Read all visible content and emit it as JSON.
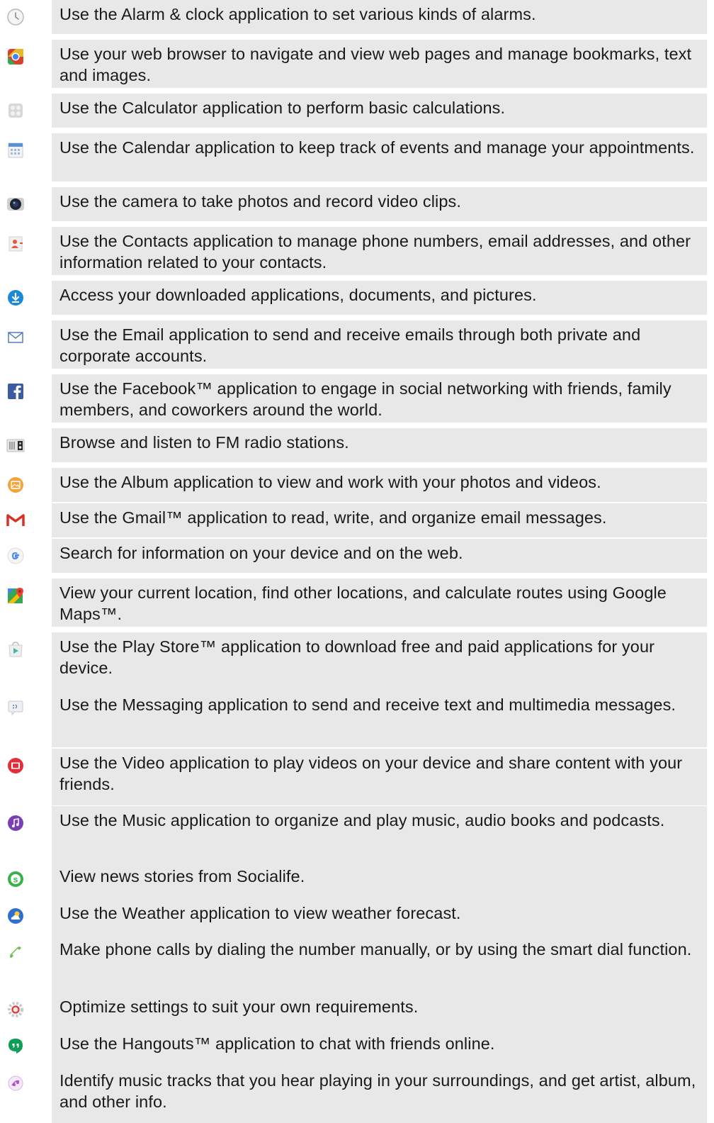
{
  "apps": [
    {
      "icon": "alarm-clock-icon",
      "text": "Use the Alarm & clock application to set various kinds of alarms."
    },
    {
      "icon": "web-browser-icon",
      "text": "Use your web browser to navigate and view web pages and manage bookmarks, text and images."
    },
    {
      "icon": "calculator-icon",
      "text": "Use the Calculator application to perform basic calculations."
    },
    {
      "icon": "calendar-icon",
      "text": "Use the Calendar application to keep track of events and manage your appointments."
    },
    {
      "icon": "camera-icon",
      "text": "Use the camera to take photos and record video clips."
    },
    {
      "icon": "contacts-icon",
      "text": "Use the Contacts application to manage phone numbers, email addresses, and other information related to your contacts."
    },
    {
      "icon": "downloads-icon",
      "text": "Access your downloaded applications, documents, and pictures."
    },
    {
      "icon": "email-icon",
      "text": "Use the Email application to send and receive emails through both private and corporate accounts."
    },
    {
      "icon": "facebook-icon",
      "text": "Use the Facebook™ application to engage in social networking with friends, family members, and coworkers around the world."
    },
    {
      "icon": "fm-radio-icon",
      "text": "Browse and listen to FM radio stations."
    },
    {
      "icon": "album-icon",
      "text": "Use the Album application to view and work with your photos and videos."
    },
    {
      "icon": "gmail-icon",
      "text": "Use the Gmail™ application to read, write, and organize email messages."
    },
    {
      "icon": "google-search-icon",
      "text": "Search for information on your device and on the web."
    },
    {
      "icon": "maps-icon",
      "text": "View your current location, find other locations, and calculate routes using Google Maps™."
    },
    {
      "icon": "play-store-icon",
      "text": "Use the Play Store™ application to download free and paid applications for your device."
    },
    {
      "icon": "messaging-icon",
      "text": "Use the Messaging application to send and receive text and multimedia messages."
    },
    {
      "icon": "video-icon",
      "text": "Use the Video application to play videos on your device and share content with your friends."
    },
    {
      "icon": "music-icon",
      "text": "Use the Music application to organize and play music, audio books and podcasts."
    },
    {
      "icon": "socialife-icon",
      "text": "View news stories from Socialife."
    },
    {
      "icon": "weather-icon",
      "text": "Use the Weather application to view weather forecast."
    },
    {
      "icon": "phone-icon",
      "text": "Make phone calls by dialing the number manually, or by using the smart dial function."
    },
    {
      "icon": "settings-icon",
      "text": "Optimize settings to suit your own requirements."
    },
    {
      "icon": "hangouts-icon",
      "text": "Use the Hangouts™ application to chat with friends online."
    },
    {
      "icon": "music-recognition-icon",
      "text": "Identify music tracks that you hear playing in your surroundings, and get artist, album, and other info."
    }
  ]
}
